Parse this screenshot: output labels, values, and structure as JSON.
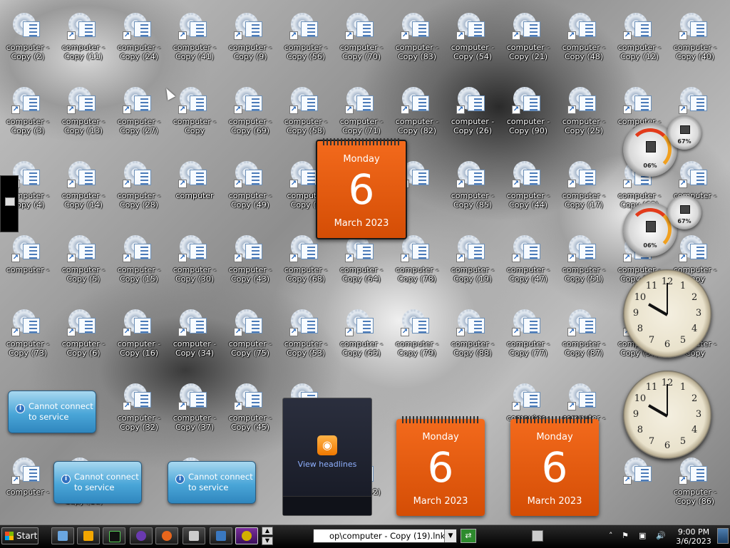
{
  "desktop": {
    "icons": [
      {
        "l1": "computer -",
        "l2": "Copy (2)",
        "shortcut": false
      },
      {
        "l1": "computer -",
        "l2": "Copy (11)",
        "shortcut": true
      },
      {
        "l1": "computer -",
        "l2": "Copy (24)",
        "shortcut": true
      },
      {
        "l1": "computer -",
        "l2": "Copy (41)",
        "shortcut": true
      },
      {
        "l1": "computer -",
        "l2": "Copy (9)",
        "shortcut": true
      },
      {
        "l1": "computer -",
        "l2": "Copy (56)",
        "shortcut": true
      },
      {
        "l1": "computer -",
        "l2": "Copy (70)",
        "shortcut": true
      },
      {
        "l1": "computer -",
        "l2": "Copy (83)",
        "shortcut": true
      },
      {
        "l1": "computer -",
        "l2": "Copy (54)",
        "shortcut": true
      },
      {
        "l1": "computer -",
        "l2": "Copy (21)",
        "shortcut": true
      },
      {
        "l1": "computer -",
        "l2": "Copy (48)",
        "shortcut": true
      },
      {
        "l1": "computer -",
        "l2": "Copy (12)",
        "shortcut": true
      },
      {
        "l1": "computer -",
        "l2": "Copy (40)",
        "shortcut": true
      },
      {
        "l1": "computer -",
        "l2": "Copy (3)",
        "shortcut": true
      },
      {
        "l1": "computer -",
        "l2": "Copy (13)",
        "shortcut": true
      },
      {
        "l1": "computer -",
        "l2": "Copy (27)",
        "shortcut": true
      },
      {
        "l1": "computer -",
        "l2": "Copy",
        "shortcut": true
      },
      {
        "l1": "computer -",
        "l2": "Copy (69)",
        "shortcut": true
      },
      {
        "l1": "computer -",
        "l2": "Copy (58)",
        "shortcut": true
      },
      {
        "l1": "computer -",
        "l2": "Copy (71)",
        "shortcut": true
      },
      {
        "l1": "computer -",
        "l2": "Copy (82)",
        "shortcut": true
      },
      {
        "l1": "computer -",
        "l2": "Copy (26)",
        "shortcut": true
      },
      {
        "l1": "computer -",
        "l2": "Copy (90)",
        "shortcut": true
      },
      {
        "l1": "computer -",
        "l2": "Copy (25)",
        "shortcut": true
      },
      {
        "l1": "computer -",
        "l2": "Cor",
        "shortcut": true
      },
      {
        "l1": "",
        "l2": "",
        "shortcut": true
      },
      {
        "l1": "computer -",
        "l2": "Copy (4)",
        "shortcut": true
      },
      {
        "l1": "computer -",
        "l2": "Copy (14)",
        "shortcut": true
      },
      {
        "l1": "computer -",
        "l2": "Copy (28)",
        "shortcut": true
      },
      {
        "l1": "computer",
        "l2": "",
        "shortcut": true
      },
      {
        "l1": "computer -",
        "l2": "Copy (49)",
        "shortcut": true
      },
      {
        "l1": "computer",
        "l2": "Copy (5",
        "shortcut": true
      },
      {
        "l1": "",
        "l2": "",
        "shortcut": true
      },
      {
        "l1": "computer -",
        "l2": "Copy (85)",
        "shortcut": true
      },
      {
        "l1": "computer -",
        "l2": "Copy (44)",
        "shortcut": true
      },
      {
        "l1": "computer -",
        "l2": "Copy (17)",
        "shortcut": true
      },
      {
        "l1": "computer -",
        "l2": "Copy (63)",
        "shortcut": true
      },
      {
        "l1": "computer -",
        "l2": "",
        "shortcut": true
      },
      {
        "l1": "computer -",
        "l2": "",
        "shortcut": true
      },
      {
        "l1": "computer -",
        "l2": "Copy (5)",
        "shortcut": true
      },
      {
        "l1": "computer -",
        "l2": "Copy (15)",
        "shortcut": true
      },
      {
        "l1": "computer -",
        "l2": "Copy (30)",
        "shortcut": true
      },
      {
        "l1": "computer -",
        "l2": "Copy (43)",
        "shortcut": true
      },
      {
        "l1": "computer -",
        "l2": "Copy (68)",
        "shortcut": true
      },
      {
        "l1": "computer -",
        "l2": "Copy (64)",
        "shortcut": true
      },
      {
        "l1": "computer -",
        "l2": "Copy (78)",
        "shortcut": true
      },
      {
        "l1": "computer -",
        "l2": "Copy (19)",
        "shortcut": true
      },
      {
        "l1": "computer -",
        "l2": "Copy (47)",
        "shortcut": true
      },
      {
        "l1": "computer -",
        "l2": "Copy (51)",
        "shortcut": true
      },
      {
        "l1": "computer -",
        "l2": "Copy (76)",
        "shortcut": true
      },
      {
        "l1": "computer -",
        "l2": "Copy",
        "shortcut": true
      },
      {
        "l1": "computer -",
        "l2": "Copy (73)",
        "shortcut": true
      },
      {
        "l1": "computer -",
        "l2": "Copy (6)",
        "shortcut": true
      },
      {
        "l1": "computer -",
        "l2": "Copy (16)",
        "shortcut": true
      },
      {
        "l1": "computer -",
        "l2": "Copy (34)",
        "shortcut": true
      },
      {
        "l1": "computer -",
        "l2": "Copy (75)",
        "shortcut": true
      },
      {
        "l1": "computer -",
        "l2": "Copy (53)",
        "shortcut": true
      },
      {
        "l1": "computer -",
        "l2": "Copy (65)",
        "shortcut": true
      },
      {
        "l1": "computer -",
        "l2": "Copy (79)",
        "shortcut": true
      },
      {
        "l1": "computer -",
        "l2": "Copy (88)",
        "shortcut": true
      },
      {
        "l1": "computer -",
        "l2": "Copy (77)",
        "shortcut": true
      },
      {
        "l1": "computer -",
        "l2": "Copy (87)",
        "shortcut": true
      },
      {
        "l1": "computer -",
        "l2": "Copy (57)",
        "shortcut": true
      },
      {
        "l1": "computer -",
        "l2": "Copy",
        "shortcut": true
      },
      {
        "l1": "computer -",
        "l2": "Copy (32)",
        "shortcut": true
      },
      {
        "l1": "computer -",
        "l2": "Copy (37)",
        "shortcut": true
      },
      {
        "l1": "computer -",
        "l2": "Copy (45)",
        "shortcut": true
      },
      {
        "l1": "computer -",
        "l2": "Copy (55)",
        "shortcut": true
      },
      {
        "l1": "computer -",
        "l2": "",
        "shortcut": true
      },
      {
        "l1": "computer -",
        "l2": "",
        "shortcut": true
      },
      {
        "l1": "computer -",
        "l2": "",
        "shortcut": true
      },
      {
        "l1": "computer -",
        "l2": "Copy (10)",
        "shortcut": true
      },
      {
        "l1": "",
        "l2": "Copy (39)",
        "shortcut": true
      },
      {
        "l1": "",
        "l2": "Copy (42)",
        "shortcut": true
      },
      {
        "l1": "",
        "l2": "",
        "shortcut": true
      },
      {
        "l1": "computer -",
        "l2": "Copy (86)",
        "shortcut": true
      },
      {
        "l1": "computer -",
        "l2": "Copy (62)",
        "shortcut": true
      }
    ]
  },
  "gadgets": {
    "calendar": {
      "weekday": "Monday",
      "day": "6",
      "month_year": "March 2023"
    },
    "notice": {
      "text": "Cannot connect to service"
    },
    "feed": {
      "text": "View headlines"
    },
    "meter": {
      "cpu": "06%",
      "ram": "67%"
    }
  },
  "taskbar": {
    "start_label": "Start",
    "address": "op\\computer - Copy (19).lnk",
    "time": "9:00 PM",
    "date": "3/6/2023"
  },
  "colors": {
    "calendar": "#e85c10",
    "notice": "#4aa6d8",
    "taskbar": "#000000"
  }
}
